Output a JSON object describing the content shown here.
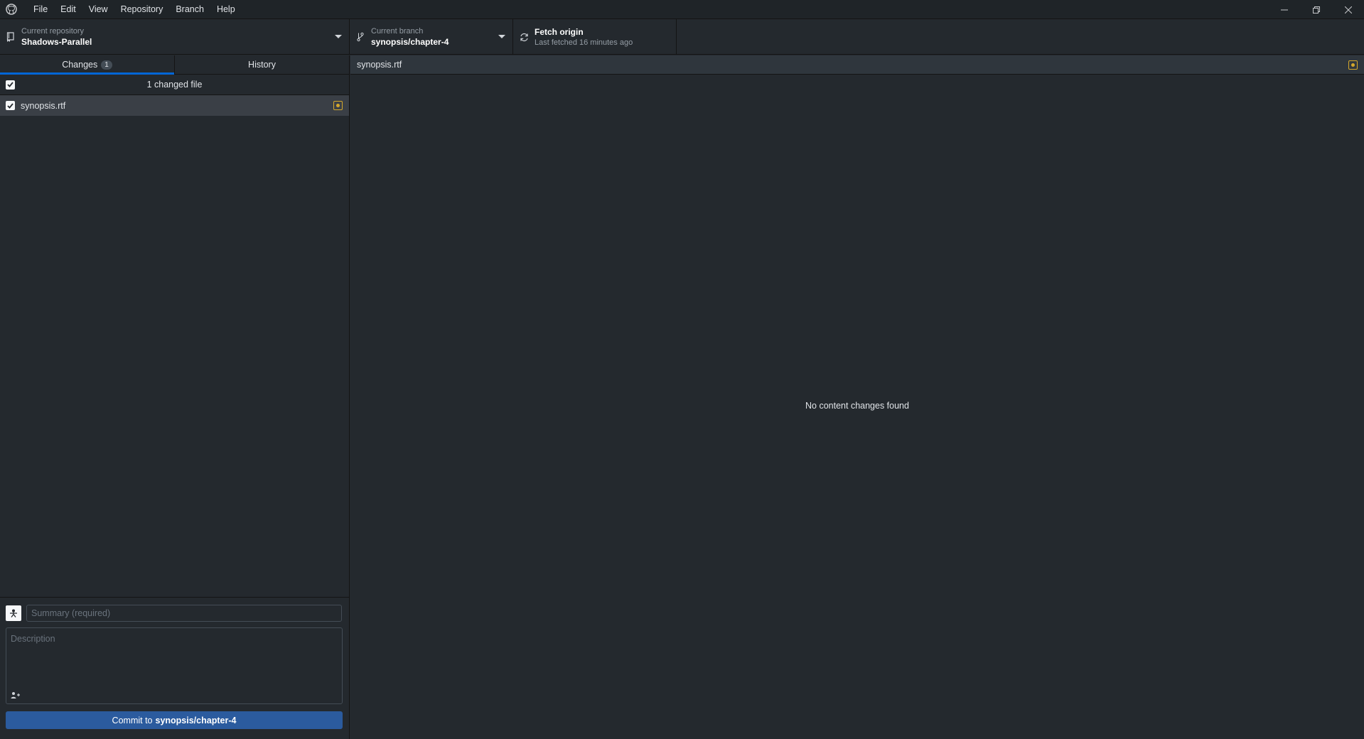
{
  "menu": [
    "File",
    "Edit",
    "View",
    "Repository",
    "Branch",
    "Help"
  ],
  "toolbar": {
    "repo_label": "Current repository",
    "repo_name": "Shadows-Parallel",
    "branch_label": "Current branch",
    "branch_name": "synopsis/chapter-4",
    "fetch_label": "Fetch origin",
    "fetch_sub": "Last fetched 16 minutes ago"
  },
  "tabs": {
    "changes_label": "Changes",
    "changes_count": "1",
    "history_label": "History"
  },
  "changes": {
    "header": "1 changed file",
    "files": [
      {
        "name": "synopsis.rtf",
        "status": "modified"
      }
    ]
  },
  "commit": {
    "summary_placeholder": "Summary (required)",
    "description_placeholder": "Description",
    "button_prefix": "Commit to",
    "button_branch": "synopsis/chapter-4"
  },
  "diff": {
    "file_name": "synopsis.rtf",
    "empty_message": "No content changes found"
  },
  "colors": {
    "accent": "#0366d6",
    "modified": "#d4a72c",
    "commit_button": "#2b5b9e"
  }
}
